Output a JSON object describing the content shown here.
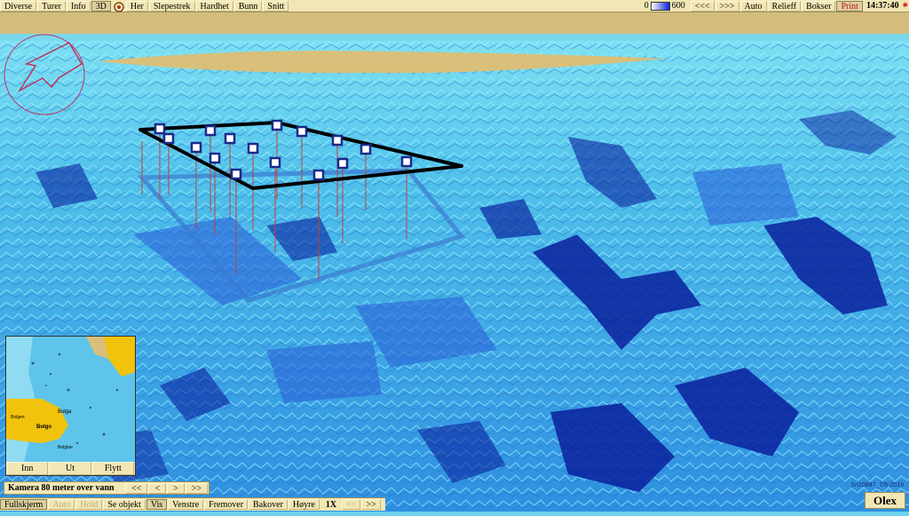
{
  "topbar": {
    "left_buttons": [
      "Diverse",
      "Turer",
      "Info",
      "3D",
      "Her",
      "Slepestrek",
      "Hardhet",
      "Bunn",
      "Snitt"
    ],
    "scale_min": "0",
    "scale_max": "600",
    "right_buttons": [
      "<<<",
      ">>>",
      "Auto",
      "Relieff",
      "Bokser",
      "Print"
    ],
    "clock": "14:37:40"
  },
  "minimap": {
    "labels": [
      "Bolga",
      "Bolgen",
      "Bolgo",
      "Bolgtue"
    ],
    "buttons": [
      "Inn",
      "Ut",
      "Flytt"
    ]
  },
  "status": {
    "camera_text": "Kamera 80 meter over vann",
    "buttons": [
      "<<",
      "<",
      ">",
      ">>"
    ]
  },
  "bottombar": {
    "buttons": [
      "Fullskjerm",
      "Auto",
      "Hold",
      "Se objekt",
      "Vis",
      "Venstre",
      "Fremover",
      "Bakover",
      "Høyre"
    ],
    "zoom": "1X",
    "nav": [
      "<<",
      ">>"
    ]
  },
  "brand": "Olex",
  "watermark": "Sn10887_7/6-2019",
  "colors": {
    "terrain_light": "#6fd2ee",
    "terrain_dark": "#0a1f9c",
    "land": "#d9bf7a",
    "panel": "#f2e7b4"
  }
}
